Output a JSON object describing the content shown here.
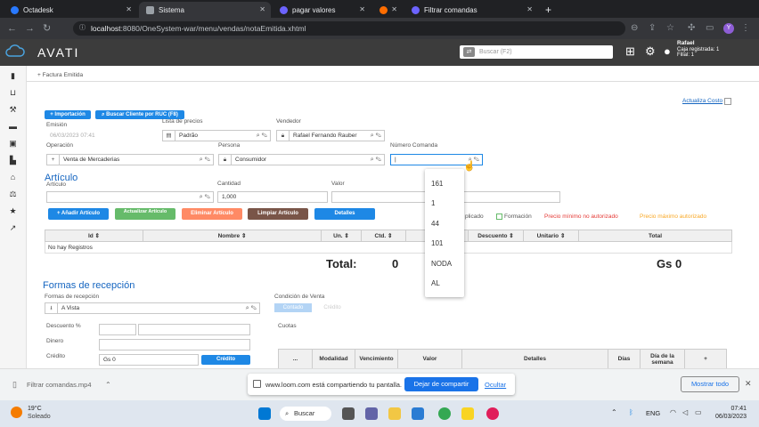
{
  "browser": {
    "tabs": [
      {
        "label": "Octadesk",
        "active": false
      },
      {
        "label": "Sistema",
        "active": true
      },
      {
        "label": "pagar valores",
        "active": false
      },
      {
        "label": "",
        "active": false
      },
      {
        "label": "Filtrar comandas",
        "active": false
      }
    ],
    "url_host": "localhost",
    "url_rest": ":8080/OneSystem-war/menu/vendas/notaEmitida.xhtml",
    "profile_letter": "Y"
  },
  "header": {
    "brand": "AVATI",
    "search_placeholder": "Buscar (F2)",
    "user_name": "Rafael",
    "user_line2": "Caja registrada: 1",
    "user_line3": "Filial: 1"
  },
  "breadcrumb": "Factura Emitida",
  "form": {
    "actualiza_costo": "Actualiza Costo",
    "importacion_btn": "Importación",
    "buscar_cliente_btn": "Buscar Cliente por RUC (F8)",
    "emision_label": "Emisión",
    "emision_value": "06/03/2023 07:41",
    "lista_label": "Lista de precios",
    "lista_value": "Padrão",
    "vendedor_label": "Vendedor",
    "vendedor_value": "Rafael Fernando Rauber",
    "operacion_label": "Operación",
    "operacion_value": "Venta de Mercaderias",
    "persona_label": "Persona",
    "persona_value": "Consumidor",
    "comanda_label": "Número Comanda",
    "comanda_value": "|"
  },
  "articulo": {
    "title": "Artículo",
    "articulo_label": "Artículo",
    "cantidad_label": "Cantidad",
    "cantidad_value": "1,000",
    "valor_label": "Valor",
    "buttons": {
      "add": "Añadir Artículo",
      "update": "Actualizar Artículo",
      "delete": "Eliminar Artículo",
      "clear": "Limpiar Artículo",
      "details": "Detalles"
    },
    "legend": {
      "aplicado": "plicado",
      "formacion": "Formación",
      "precio_minimo": "Precio mínimo no autorizado",
      "precio_maximo": "Precio máximo autorizado"
    },
    "table": {
      "headers": [
        "Id",
        "Nombre",
        "Un.",
        "Ctd.",
        "",
        "Descuento",
        "Unitario",
        "Total"
      ],
      "empty": "No hay Registros"
    },
    "total_label": "Total:",
    "total_qty": "0",
    "total_amount": "Gs 0"
  },
  "dropdown": {
    "options": [
      "161",
      "1",
      "44",
      "101",
      "NODA",
      "AL"
    ]
  },
  "formas": {
    "title": "Formas de recepción",
    "label": "Formas de recepción",
    "value": "A Vista",
    "condicion_label": "Condición de Venta",
    "contado": "Contado",
    "credito_tab": "Crédito",
    "descuento_label": "Descuento %",
    "dinero_label": "Dinero",
    "credito_label": "Crédito",
    "credito_value": "Gs 0",
    "credito_btn": "Crédito",
    "cuotas_label": "Cuotas",
    "cuotas_headers": [
      "...",
      "Modalidad",
      "Vencimiento",
      "Valor",
      "Detalles",
      "Días",
      "Día de la semana",
      "+"
    ]
  },
  "sharebar": {
    "file": "Filtrar comandas.mp4",
    "message": "www.loom.com está compartiendo tu pantalla.",
    "stop_btn": "Dejar de compartir",
    "hide_link": "Ocultar",
    "show_all": "Mostrar todo"
  },
  "taskbar": {
    "temp": "19°C",
    "weather": "Soleado",
    "search": "Buscar",
    "lang": "ENG",
    "time": "07:41",
    "date": "06/03/2023"
  }
}
